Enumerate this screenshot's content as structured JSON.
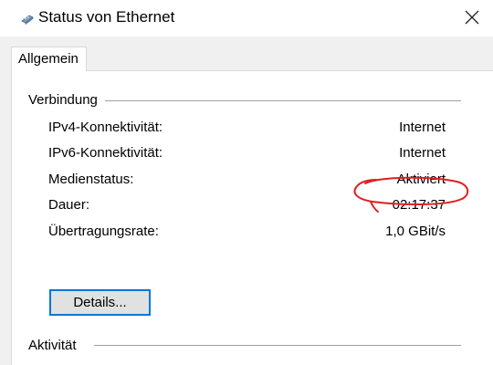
{
  "window": {
    "title": "Status von Ethernet",
    "icon": "network-adapter-icon",
    "close_icon": "close-icon"
  },
  "tabs": [
    {
      "label": "Allgemein",
      "selected": true
    }
  ],
  "verbindung": {
    "heading": "Verbindung",
    "rows": [
      {
        "label": "IPv4-Konnektivität:",
        "value": "Internet"
      },
      {
        "label": "IPv6-Konnektivität:",
        "value": "Internet"
      },
      {
        "label": "Medienstatus:",
        "value": "Aktiviert"
      },
      {
        "label": "Dauer:",
        "value": "02:17:37"
      },
      {
        "label": "Übertragungsrate:",
        "value": "1,0 GBit/s"
      }
    ],
    "details_button": "Details..."
  },
  "aktivitaet": {
    "heading": "Aktivität"
  },
  "colors": {
    "focus_border": "#0078d7",
    "annotation": "#e02020",
    "body_bg": "#f0f0f0"
  }
}
